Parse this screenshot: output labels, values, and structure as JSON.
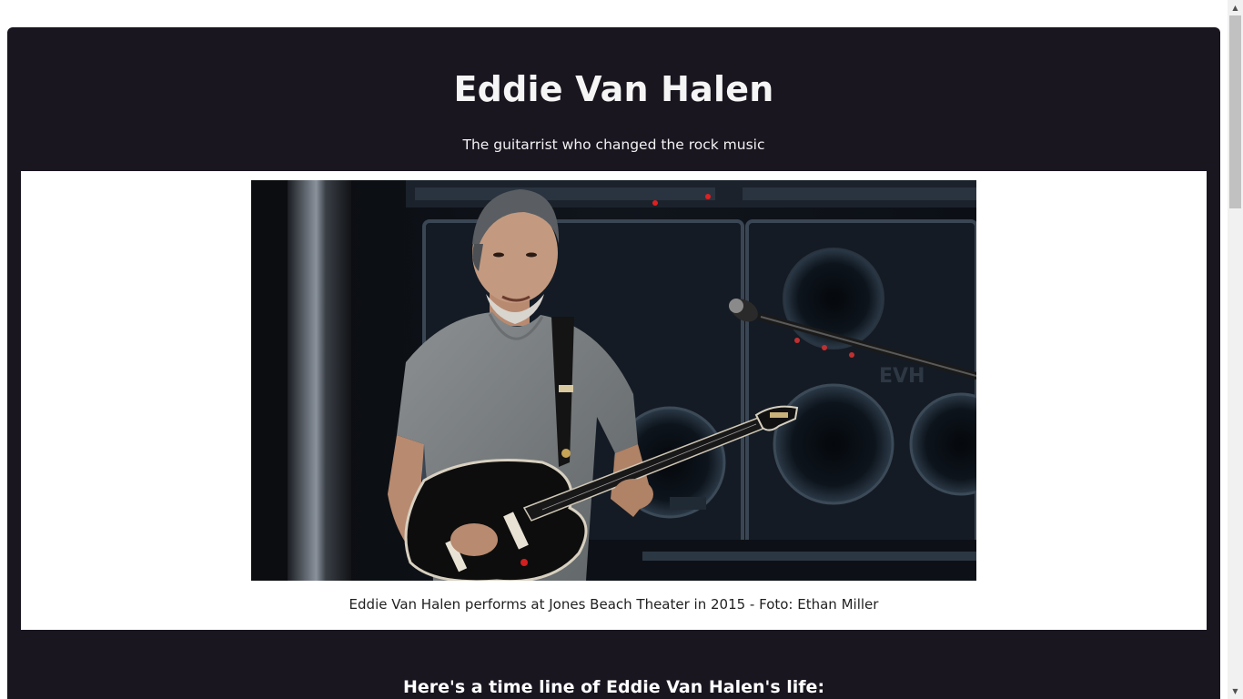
{
  "header": {
    "title": "Eddie Van Halen",
    "tagline": "The guitarrist who changed the rock music"
  },
  "figure": {
    "caption": "Eddie Van Halen performs at Jones Beach Theater in 2015 - Foto: Ethan Miller",
    "amp_logo": "EVH"
  },
  "timeline": {
    "heading": "Here's a time line of Eddie Van Halen's life:"
  },
  "scrollbar": {
    "up_icon": "▲",
    "down_icon": "▼"
  },
  "colors": {
    "card_background": "#1a1620",
    "panel_background": "#ffffff",
    "text_light": "#ffffff"
  }
}
